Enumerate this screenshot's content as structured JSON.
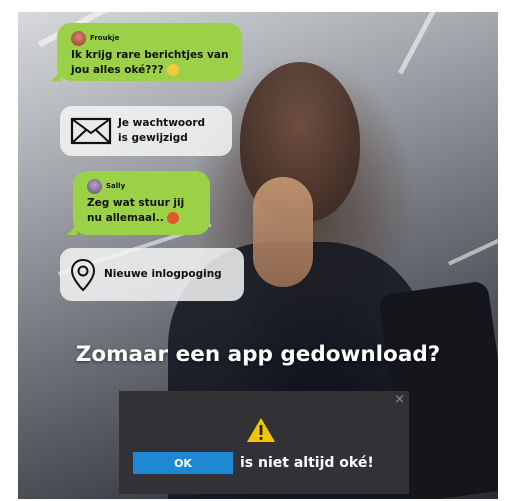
{
  "chat1": {
    "sender": "Froukje",
    "message": "Ik krijg rare berichtjes van jou alles oké???"
  },
  "notification_password": {
    "icon": "envelope-icon",
    "text": "Je wachtwoord is gewijzigd"
  },
  "chat2": {
    "sender": "Sally",
    "message": "Zeg wat stuur jij nu allemaal.."
  },
  "notification_login": {
    "icon": "location-pin-icon",
    "text": "Nieuwe inlogpoging"
  },
  "headline": "Zomaar een app gedownload?",
  "dialog": {
    "icon": "warning-icon",
    "ok_label": "OK",
    "message": "is niet altijd oké!",
    "close_label": "×"
  },
  "colors": {
    "chat_bubble": "#9bd146",
    "ok_button": "#1e88d3",
    "dialog_bg": "#323236",
    "warning": "#f2c700"
  }
}
